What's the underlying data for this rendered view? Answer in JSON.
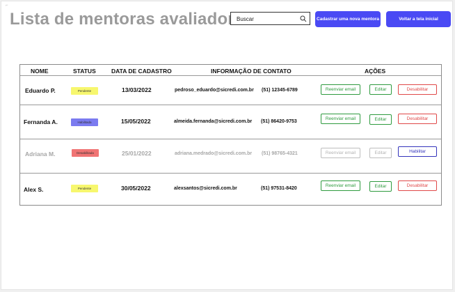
{
  "header": {
    "title": "Lista de mentoras avaliadoras",
    "search_placeholder": "Buscar",
    "new_mentor_button": "Cadastrar uma nova mentora",
    "back_button": "Voltar a tela inicial"
  },
  "table": {
    "columns": {
      "name": "NOME",
      "status": "STATUS",
      "date": "DATA DE CADASTRO",
      "contact": "INFORMAÇÃO DE CONTATO",
      "actions": "AÇÕES"
    },
    "rows": [
      {
        "name": "Eduardo P.",
        "status": "Pendente",
        "date": "13/03/2022",
        "email": "pedroso_eduardo@sicredi.com.br",
        "phone": "(51) 12345-6789",
        "resend": "Reenviar email",
        "edit": "Editar",
        "toggle": "Desabilitar"
      },
      {
        "name": "Fernanda A.",
        "status": "Habilitada",
        "date": "15/05/2022",
        "email": "almeida.fernanda@sicredi.com.br",
        "phone": "(51) 86420-9753",
        "resend": "Reenviar email",
        "edit": "Editar",
        "toggle": "Desabilitar"
      },
      {
        "name": "Adriana M.",
        "status": "Desabilitada",
        "date": "25/01/2022",
        "email": "adriana.medrado@sicredi.com.br",
        "phone": "(51) 98765-4321",
        "resend": "Reenviar email",
        "edit": "Editar",
        "toggle": "Habilitar"
      },
      {
        "name": "Alex S.",
        "status": "Pendente",
        "date": "30/05/2022",
        "email": "alexsantos@sicredi.com.br",
        "phone": "(51) 97531-8420",
        "resend": "Reenviar email",
        "edit": "Editar",
        "toggle": "Desabilitar"
      }
    ]
  },
  "colors": {
    "primary": "#4a4af4",
    "pending": "#f7f76e",
    "enabled": "#7b7bf0",
    "disabled": "#f07474",
    "action_green": "#2e9a3e",
    "action_red": "#e04848",
    "action_blue": "#3333bb"
  }
}
